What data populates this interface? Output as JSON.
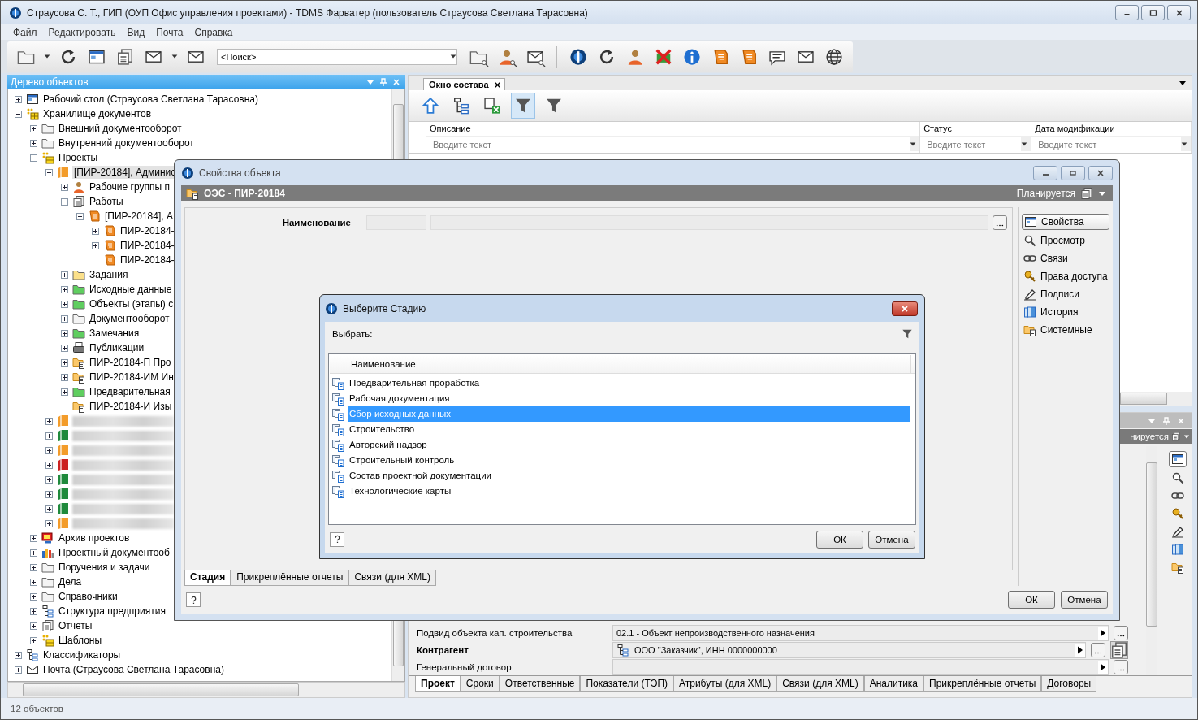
{
  "window": {
    "title": "Страусова С. Т., ГИП (ОУП Офис управления проектами) - TDMS Фарватер (пользователь Страусова Светлана Тарасовна)"
  },
  "menu": [
    "Файл",
    "Редактировать",
    "Вид",
    "Почта",
    "Справка"
  ],
  "toolbar": {
    "search": {
      "value": "<Поиск>"
    }
  },
  "object_tree": {
    "title": "Дерево объектов",
    "items": [
      {
        "label": "Рабочий стол (Страусова Светлана Тарасовна)",
        "kind": "desktop",
        "expanded": false,
        "selected": false
      },
      {
        "label": "Хранилище документов",
        "kind": "storage",
        "expanded": true,
        "selected": false,
        "children": [
          {
            "label": "Внешний документооборот",
            "kind": "folder",
            "expanded": false,
            "selected": false
          },
          {
            "label": "Внутренний документооборот",
            "kind": "folder",
            "expanded": false,
            "selected": false
          },
          {
            "label": "Проекты",
            "kind": "storage",
            "expanded": true,
            "selected": false,
            "children": [
              {
                "label": "[ПИР-20184], Админис",
                "kind": "project",
                "color": "#f39c2a",
                "expanded": true,
                "selected": true,
                "children": [
                  {
                    "label": "Рабочие группы п",
                    "kind": "group",
                    "expanded": false,
                    "selected": false
                  },
                  {
                    "label": "Работы",
                    "kind": "works",
                    "expanded": true,
                    "selected": false,
                    "children": [
                      {
                        "label": "[ПИР-20184], А",
                        "kind": "work",
                        "expanded": true,
                        "selected": false,
                        "children": [
                          {
                            "label": "ПИР-20184-",
                            "kind": "work",
                            "expanded": false,
                            "selected": false
                          },
                          {
                            "label": "ПИР-20184-",
                            "kind": "work",
                            "expanded": false,
                            "selected": false
                          },
                          {
                            "label": "ПИР-20184-",
                            "kind": "work",
                            "selected": false
                          }
                        ]
                      }
                    ]
                  },
                  {
                    "label": "Задания",
                    "kind": "folder-yellow",
                    "expanded": false,
                    "selected": false
                  },
                  {
                    "label": "Исходные данные",
                    "kind": "folder-green",
                    "expanded": false,
                    "selected": false
                  },
                  {
                    "label": "Объекты (этапы) с",
                    "kind": "folder-green",
                    "expanded": false,
                    "selected": false
                  },
                  {
                    "label": "Документооборот",
                    "kind": "folder",
                    "expanded": false,
                    "selected": false
                  },
                  {
                    "label": "Замечания",
                    "kind": "folder-green",
                    "expanded": false,
                    "selected": false
                  },
                  {
                    "label": "Публикации",
                    "kind": "printer",
                    "expanded": false,
                    "selected": false
                  },
                  {
                    "label": "ПИР-20184-П Про",
                    "kind": "doc-folder",
                    "expanded": false,
                    "selected": false
                  },
                  {
                    "label": "ПИР-20184-ИМ Ин",
                    "kind": "doc-folder",
                    "expanded": false,
                    "selected": false
                  },
                  {
                    "label": "Предварительная",
                    "kind": "folder-green",
                    "expanded": false,
                    "selected": false
                  },
                  {
                    "label": "ПИР-20184-И Изы",
                    "kind": "doc-folder",
                    "selected": false
                  }
                ]
              },
              {
                "kind": "redacted-project",
                "color": "#f39c2a",
                "expanded": false,
                "selected": false
              },
              {
                "kind": "redacted-project",
                "color": "#1f8a3c",
                "expanded": false,
                "selected": false
              },
              {
                "kind": "redacted-project",
                "color": "#f39c2a",
                "expanded": false,
                "selected": false
              },
              {
                "kind": "redacted-project",
                "color": "#cc2222",
                "expanded": false,
                "selected": false
              },
              {
                "kind": "redacted-project",
                "color": "#1f8a3c",
                "expanded": false,
                "selected": false
              },
              {
                "kind": "redacted-project",
                "color": "#1f8a3c",
                "expanded": false,
                "selected": false
              },
              {
                "kind": "redacted-project",
                "color": "#1f8a3c",
                "expanded": false,
                "selected": false
              },
              {
                "kind": "redacted-project",
                "color": "#f39c2a",
                "expanded": false,
                "selected": false
              }
            ]
          },
          {
            "label": "Архив проектов",
            "kind": "archive",
            "expanded": false,
            "selected": false
          },
          {
            "label": "Проектный документооб",
            "kind": "chart",
            "expanded": false,
            "selected": false
          },
          {
            "label": "Поручения и задачи",
            "kind": "folder",
            "expanded": false,
            "selected": false
          },
          {
            "label": "Дела",
            "kind": "folder",
            "expanded": false,
            "selected": false
          },
          {
            "label": "Справочники",
            "kind": "folder",
            "expanded": false,
            "selected": false
          },
          {
            "label": "Структура предприятия",
            "kind": "structure",
            "expanded": false,
            "selected": false
          },
          {
            "label": "Отчеты",
            "kind": "reports",
            "expanded": false,
            "selected": false
          },
          {
            "label": "Шаблоны",
            "kind": "templates",
            "expanded": false,
            "selected": false
          }
        ]
      },
      {
        "label": "Классификаторы",
        "kind": "classifier",
        "expanded": false,
        "selected": false
      },
      {
        "label": "Почта (Страусова Светлана Тарасовна)",
        "kind": "mail",
        "expanded": false,
        "selected": false
      }
    ]
  },
  "composition_window": {
    "tab": {
      "label": "Окно состава",
      "selected": true
    },
    "filter_on": true,
    "columns": [
      {
        "label": "Описание",
        "placeholder": "Введите текст"
      },
      {
        "label": "Статус",
        "placeholder": "Введите текст"
      },
      {
        "label": "Дата модификации",
        "placeholder": "Введите текст"
      }
    ]
  },
  "object_panel": {
    "status": "нируется",
    "sidebar": [
      {
        "selected": true
      },
      {
        "selected": false
      },
      {
        "selected": false
      },
      {
        "selected": false
      },
      {
        "selected": false
      },
      {
        "selected": false
      },
      {
        "selected": false
      }
    ],
    "fields": [
      {
        "label": "Подвид объекта кап. строительства",
        "value": "02.1 - Объект непроизводственного назначения",
        "bold": false,
        "kind": "plain"
      },
      {
        "label": "Контрагент",
        "value": "ООО \"Заказчик\", ИНН 0000000000",
        "bold": true,
        "kind": "reference"
      },
      {
        "label": "Генеральный договор",
        "bold": false,
        "kind": "plain"
      }
    ],
    "tabs": [
      {
        "label": "Проект",
        "selected": true
      },
      {
        "label": "Сроки",
        "selected": false
      },
      {
        "label": "Ответственные",
        "selected": false
      },
      {
        "label": "Показатели (ТЭП)",
        "selected": false
      },
      {
        "label": "Атрибуты (для XML)",
        "selected": false
      },
      {
        "label": "Связи (для XML)",
        "selected": false
      },
      {
        "label": "Аналитика",
        "selected": false
      },
      {
        "label": "Прикреплённые отчеты",
        "selected": false
      },
      {
        "label": "Договоры",
        "selected": false
      }
    ]
  },
  "properties_dialog": {
    "title": "Свойства объекта",
    "object": "ОЭС - ПИР-20184",
    "status": "Планируется",
    "field_label": "Наименование",
    "sections": [
      {
        "label": "Свойства",
        "kind": "properties",
        "selected": true
      },
      {
        "label": "Просмотр",
        "kind": "view",
        "selected": false
      },
      {
        "label": "Связи",
        "kind": "links",
        "selected": false
      },
      {
        "label": "Права доступа",
        "kind": "access",
        "selected": false
      },
      {
        "label": "Подписи",
        "kind": "signatures",
        "selected": false
      },
      {
        "label": "История",
        "kind": "history",
        "selected": false
      },
      {
        "label": "Системные",
        "kind": "system",
        "selected": false
      }
    ],
    "tabs": [
      {
        "label": "Стадия",
        "selected": true
      },
      {
        "label": "Прикреплённые отчеты",
        "selected": false
      },
      {
        "label": "Связи (для XML)",
        "selected": false
      }
    ],
    "buttons": [
      "ОК",
      "Отмена"
    ]
  },
  "stage_dialog": {
    "title": "Выберите Стадию",
    "prompt": "Выбрать:",
    "column": "Наименование",
    "rows": [
      {
        "label": "Предварительная проработка",
        "selected": false
      },
      {
        "label": "Рабочая документация",
        "selected": false
      },
      {
        "label": "Сбор исходных данных",
        "selected": true
      },
      {
        "label": "Строительство",
        "selected": false
      },
      {
        "label": "Авторский надзор",
        "selected": false
      },
      {
        "label": "Строительный контроль",
        "selected": false
      },
      {
        "label": "Состав проектной документации",
        "selected": false
      },
      {
        "label": "Технологические карты",
        "selected": false
      }
    ],
    "buttons": [
      "ОК",
      "Отмена"
    ]
  },
  "status_bar": {
    "text": "12 объектов"
  }
}
